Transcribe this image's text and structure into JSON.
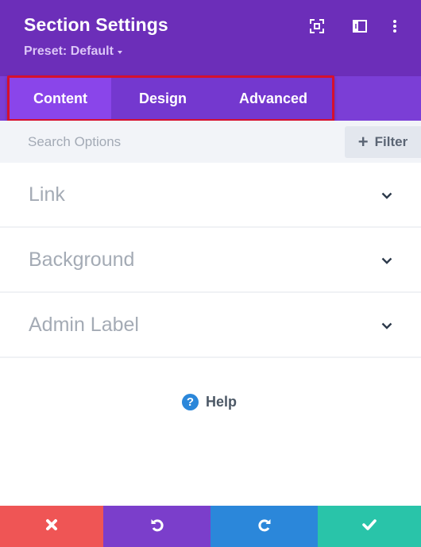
{
  "header": {
    "title": "Section Settings",
    "preset_label": "Preset: Default",
    "icons": [
      "fullscreen-icon",
      "split-view-icon",
      "more-options-icon"
    ]
  },
  "tabs": [
    {
      "label": "Content",
      "active": true
    },
    {
      "label": "Design",
      "active": false
    },
    {
      "label": "Advanced",
      "active": false
    }
  ],
  "search": {
    "placeholder": "Search Options",
    "value": "",
    "filter_label": "Filter",
    "filter_icon": "plus-icon"
  },
  "accordions": [
    {
      "label": "Link",
      "icon": "chevron-down-icon"
    },
    {
      "label": "Background",
      "icon": "chevron-down-icon"
    },
    {
      "label": "Admin Label",
      "icon": "chevron-down-icon"
    }
  ],
  "help": {
    "label": "Help",
    "icon_glyph": "?"
  },
  "footer": {
    "buttons": [
      {
        "name": "discard",
        "icon": "close-icon",
        "color": "#ef5555"
      },
      {
        "name": "undo",
        "icon": "undo-icon",
        "color": "#7b3ecb"
      },
      {
        "name": "redo",
        "icon": "redo-icon",
        "color": "#2b87da"
      },
      {
        "name": "save",
        "icon": "check-icon",
        "color": "#29c4a9"
      }
    ]
  },
  "colors": {
    "header_bg": "#6c2eb9",
    "tabbar_bg": "#7b3ed6",
    "active_tab_bg": "#8a45ea",
    "highlight_border": "#d6102e",
    "help_icon": "#2b87da"
  }
}
